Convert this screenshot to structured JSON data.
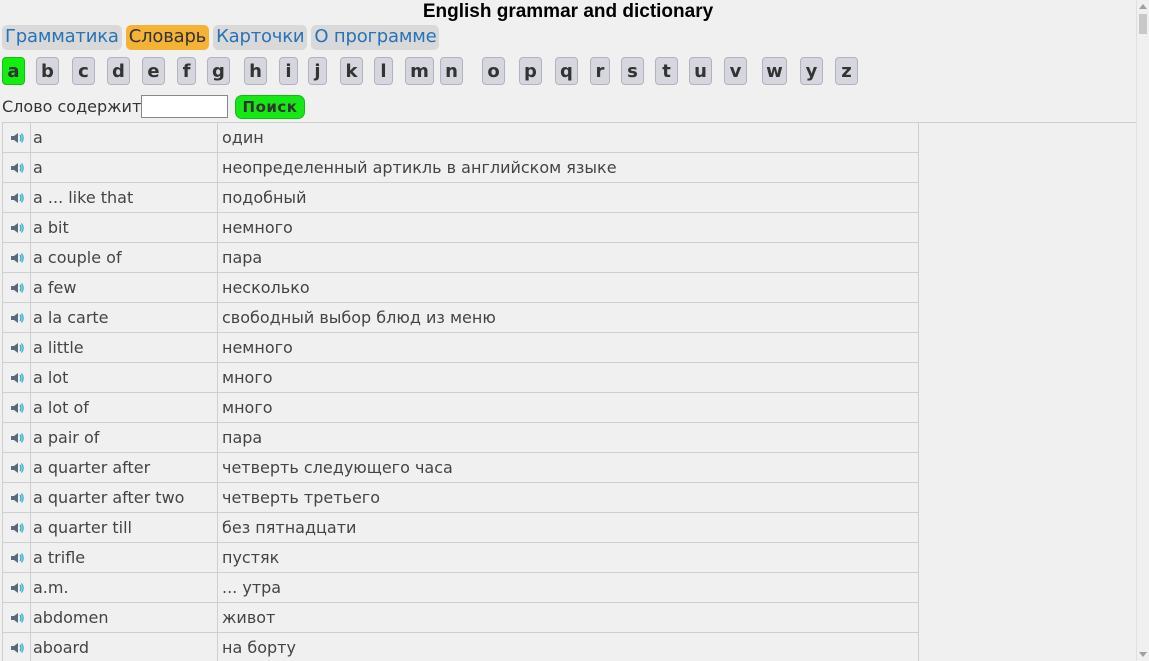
{
  "header": {
    "title": "English grammar and dictionary"
  },
  "tabs": [
    {
      "label": "Грамматика",
      "active": false
    },
    {
      "label": "Словарь",
      "active": true
    },
    {
      "label": "Карточки",
      "active": false
    },
    {
      "label": "О программе",
      "active": false
    }
  ],
  "alphabet": {
    "active": "a",
    "letters": [
      "a",
      "b",
      "c",
      "d",
      "e",
      "f",
      "g",
      "h",
      "i",
      "j",
      "k",
      "l",
      "m",
      "n",
      "o",
      "p",
      "q",
      "r",
      "s",
      "t",
      "u",
      "v",
      "w",
      "y",
      "z"
    ]
  },
  "search": {
    "label": "Слово содержит",
    "value": "",
    "button_label": "Поиск"
  },
  "table": {
    "icon": "speaker-icon",
    "rows": [
      {
        "en": "a",
        "ru": "один"
      },
      {
        "en": "a",
        "ru": "неопределенный артикль в английском языке"
      },
      {
        "en": "a ... like that",
        "ru": "подобный"
      },
      {
        "en": "a bit",
        "ru": "немного"
      },
      {
        "en": "a couple of",
        "ru": "пара"
      },
      {
        "en": "a few",
        "ru": "несколько"
      },
      {
        "en": "a la carte",
        "ru": "свободный выбор блюд из меню"
      },
      {
        "en": "a little",
        "ru": "немного"
      },
      {
        "en": "a lot",
        "ru": "много"
      },
      {
        "en": "a lot of",
        "ru": "много"
      },
      {
        "en": "a pair of",
        "ru": "пара"
      },
      {
        "en": "a quarter after",
        "ru": "четверть следующего часа"
      },
      {
        "en": "a quarter after two",
        "ru": "четверть третьего"
      },
      {
        "en": "a quarter till",
        "ru": "без пятнадцати"
      },
      {
        "en": "a trifle",
        "ru": "пустяк"
      },
      {
        "en": "a.m.",
        "ru": "... утра"
      },
      {
        "en": "abdomen",
        "ru": "живот"
      },
      {
        "en": "aboard",
        "ru": "на борту"
      }
    ]
  },
  "colors": {
    "tab_text": "#2673b8",
    "tab_active_bg": "#f5b335",
    "letter_active_bg": "#12ee12",
    "search_button_bg": "#16e816"
  }
}
